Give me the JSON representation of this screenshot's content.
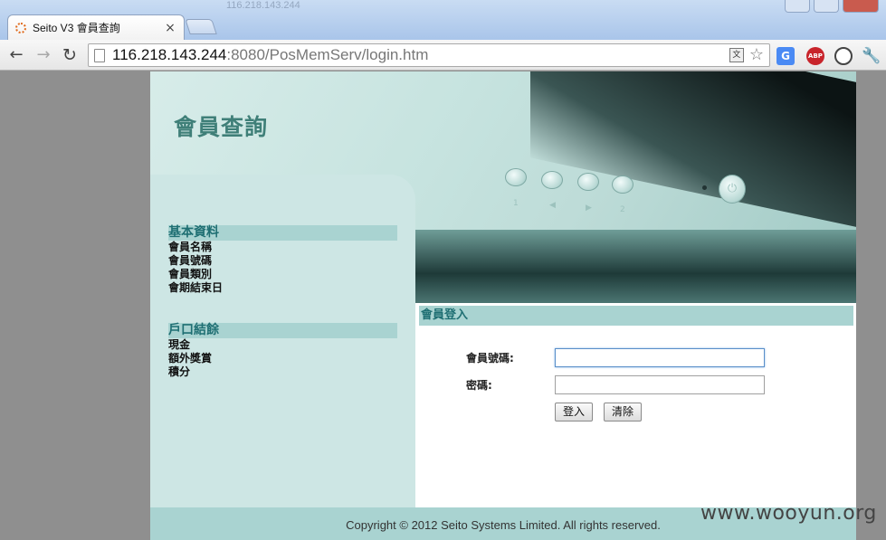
{
  "browser": {
    "tab_title": "Seito V3 會員查詢",
    "tab_close": "×",
    "url_host": "116.218.143.244",
    "url_rest": ":8080/PosMemServ/login.htm",
    "blurred_url": "116.218.143.244"
  },
  "banner": {
    "title": "會員查詢",
    "button_labels": [
      "1",
      "◀",
      "▶",
      "2"
    ],
    "power_symbol": "⏻"
  },
  "sidebar": {
    "sections": [
      {
        "heading": "基本資料",
        "items": [
          "會員名稱",
          "會員號碼",
          "會員類別",
          "會期結束日"
        ]
      },
      {
        "heading": "戶口結餘",
        "items": [
          "現金",
          "額外獎賞",
          "積分"
        ]
      }
    ]
  },
  "login": {
    "heading": "會員登入",
    "member_no_label": "會員號碼:",
    "password_label": "密碼:",
    "member_no_value": "",
    "password_value": "",
    "login_button": "登入",
    "clear_button": "清除"
  },
  "footer": {
    "copyright": "Copyright © 2012 Seito Systems Limited. All rights reserved."
  },
  "watermark": "www.wooyun.org",
  "icons": {
    "back": "←",
    "forward": "→",
    "reload": "↻",
    "star": "☆",
    "translate": "文",
    "google_translate": "G",
    "abp": "ABP",
    "wrench": "🔧"
  },
  "colors": {
    "accent_heading": "#1f6f73",
    "panel_bg": "#cde6e4",
    "band_bg": "#a9d3d1"
  }
}
